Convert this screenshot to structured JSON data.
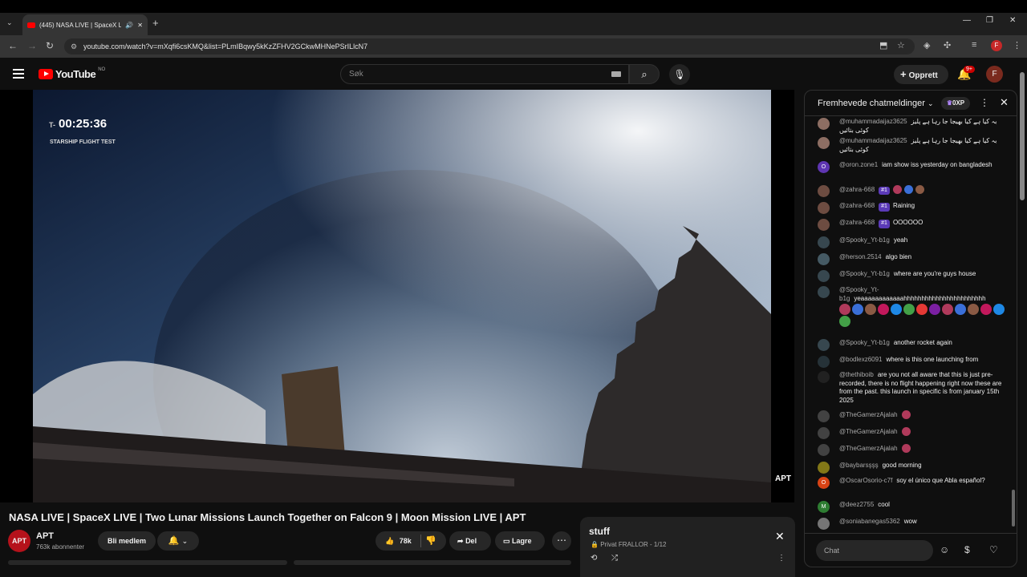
{
  "browser": {
    "tab_title": "(445) NASA LIVE | SpaceX LI",
    "url": "youtube.com/watch?v=mXqfi6csKMQ&list=PLmIBqwy5kKzZFHV2GCkwMHNePSrILlcN7",
    "new_tab": "+",
    "avatar_letter": "F"
  },
  "header": {
    "logo": "YouTube",
    "logo_country": "NO",
    "search_placeholder": "Søk",
    "create_label": "Opprett",
    "notif_count": "9+",
    "account_letter": "F"
  },
  "video": {
    "timer_prefix": "T-",
    "timer": "00:25:36",
    "flight_label": "STARSHIP FLIGHT TEST",
    "watermark": "APT",
    "title": "NASA LIVE | SpaceX LIVE | Two Lunar Missions Launch Together on Falcon 9 | Moon Mission LIVE | APT"
  },
  "channel": {
    "name": "APT",
    "subscribers": "763k abonnenter",
    "join_label": "Bli medlem",
    "likes": "78k",
    "share_label": "Del",
    "save_label": "Lagre"
  },
  "playlist": {
    "title": "stuff",
    "privacy": "Privat",
    "owner_progress": "FRALLOR - 1/12"
  },
  "chat": {
    "title": "Fremhevede chatmeldinger",
    "xp": "0XP",
    "input_placeholder": "Chat",
    "messages": [
      {
        "author": "@muhammadaijaz3625",
        "text": "بہ کیا ہے کیا بھیجا جا رہا ہے پلیز کوئی بتائیں",
        "av": "#8d6e63"
      },
      {
        "author": "@muhammadaijaz3625",
        "text": "بہ کیا ہے کیا بھیجا جا رہا ہے پلیز کوئی بتائیں",
        "av": "#8d6e63"
      },
      {
        "author": "@oron.zone1",
        "text": "iam show iss yesterday on bangladesh",
        "av": "#5e35b1",
        "letter": "O"
      },
      {
        "author": "@zahra-668",
        "badge": "#1",
        "text": "",
        "emojis": 3,
        "av": "#6d4c41"
      },
      {
        "author": "@zahra-668",
        "badge": "#1",
        "text": "Raining",
        "av": "#6d4c41"
      },
      {
        "author": "@zahra-668",
        "badge": "#1",
        "text": "OOOOOO",
        "av": "#6d4c41"
      },
      {
        "author": "@Spooky_Yt-b1g",
        "text": "yeah",
        "av": "#37474f"
      },
      {
        "author": "@herson.2514",
        "text": "algo bien",
        "av": "#455a64"
      },
      {
        "author": "@Spooky_Yt-b1g",
        "text": "where are you're guys house",
        "av": "#37474f"
      },
      {
        "author": "@Spooky_Yt-b1g",
        "text": "yeaaaaaaaaaaaahhhhhhhhhhhhhhhhhhhhhhh",
        "emojis": 14,
        "av": "#37474f"
      },
      {
        "author": "@Spooky_Yt-b1g",
        "text": "another rocket again",
        "av": "#37474f"
      },
      {
        "author": "@bodlexz6091",
        "text": "where is this one launching from",
        "av": "#263238"
      },
      {
        "author": "@thethiboib",
        "text": "are you not all aware that this is just pre-recorded, there is no flight happening right now these are from the past. this launch in specific is from january 15th 2025",
        "av": "#212121"
      },
      {
        "author": "@TheGamerzAjalah",
        "text": "",
        "emojis": 1,
        "av": "#424242"
      },
      {
        "author": "@TheGamerzAjalah",
        "text": "",
        "emojis": 1,
        "av": "#424242"
      },
      {
        "author": "@TheGamerzAjalah",
        "text": "",
        "emojis": 1,
        "av": "#424242"
      },
      {
        "author": "@baybarsşşş",
        "text": "good morning",
        "av": "#827717"
      },
      {
        "author": "@OscarOsorio-c7f",
        "text": "soy el único que Abla español?",
        "av": "#d84315",
        "letter": "O"
      },
      {
        "author": "@deez2755",
        "text": "cool",
        "av": "#2e7d32",
        "letter": "M"
      },
      {
        "author": "@soniabanegas5362",
        "text": "wow",
        "av": "#757575"
      }
    ]
  }
}
